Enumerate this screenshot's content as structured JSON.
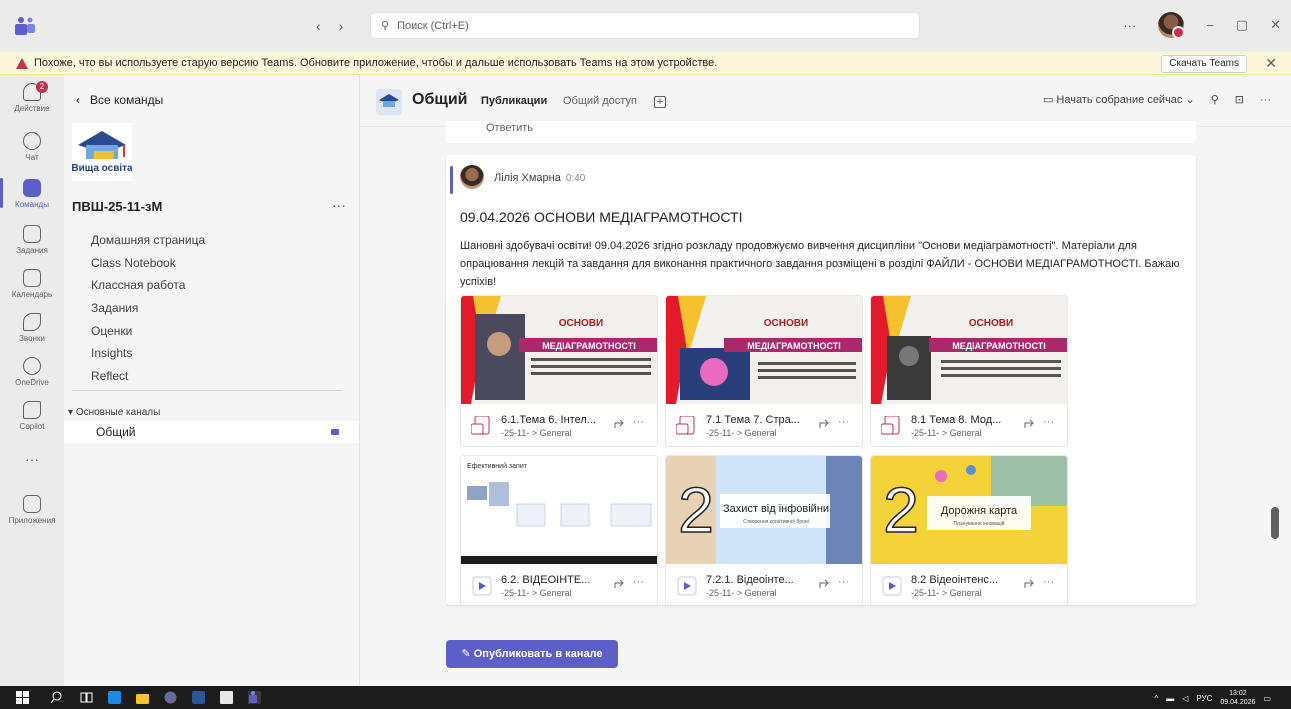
{
  "titlebar": {
    "search_placeholder": "Поиск (Ctrl+E)",
    "back": "‹",
    "forward": "›",
    "more": "···",
    "minimize": "−",
    "restore": "▢",
    "close": "✕"
  },
  "banner": {
    "text": "Похоже, что вы используете старую версию Teams. Обновите приложение, чтобы и дальше использовать Teams на этом устройстве.",
    "button": "Скачать Teams",
    "close": "✕"
  },
  "rail": {
    "items": [
      {
        "label": "Действие",
        "badge": "2"
      },
      {
        "label": "Чат"
      },
      {
        "label": "Команды"
      },
      {
        "label": "Задания"
      },
      {
        "label": "Календарь"
      },
      {
        "label": "Звонки"
      },
      {
        "label": "OneDrive"
      },
      {
        "label": "Copilot"
      },
      {
        "label": "···"
      },
      {
        "label": "Приложения"
      }
    ]
  },
  "sidebar": {
    "back_label": "Все команды",
    "logo_text": "Вища освіта",
    "team_name": "ПВШ-25-11-зМ",
    "team_more": "···",
    "nav": [
      "Домашняя страница",
      "Class Notebook",
      "Классная работа",
      "Задания",
      "Оценки",
      "Insights",
      "Reflect"
    ],
    "channels_header": "Основные каналы",
    "channel": "Общий"
  },
  "header": {
    "channel_title": "Общий",
    "tabs": [
      "Публикации",
      "Общий доступ"
    ],
    "add_tab": "+",
    "meet_label": "Начать собрание сейчас",
    "more": "···"
  },
  "reply_strip": {
    "label": "Ответить"
  },
  "post": {
    "author": "Лілія Хмарна",
    "time": "0:40",
    "title": "09.04.2026 ОСНОВИ МЕДІАГРАМОТНОСТІ",
    "body": "Шановні здобувачі освіти! 09.04.2026 згідно розкладу продовжуємо вивчення дисципліни \"Основи медіаграмотності\". Матеріали для опрацювання лекцій та завдання для виконання практичного завдання розміщені в розділі ФАЙЛИ - ОСНОВИ МЕДІАГРАМОТНОСТІ. Бажаю успіхів!",
    "files": [
      {
        "name": "6.1.Тема 6. Інтел...",
        "path": "-25-11- > General",
        "type": "pptx",
        "thumb_title": "ОСНОВИ",
        "thumb_sub": "МЕДІАГРАМОТНОСТІ"
      },
      {
        "name": "7.1 Тема 7. Стра...",
        "path": "-25-11- > General",
        "type": "pptx",
        "thumb_title": "ОСНОВИ",
        "thumb_sub": "МЕДІАГРАМОТНОСТІ"
      },
      {
        "name": "8.1 Тема 8. Мод...",
        "path": "-25-11- > General",
        "type": "pptx",
        "thumb_title": "ОСНОВИ",
        "thumb_sub": "МЕДІАГРАМОТНОСТІ"
      },
      {
        "name": "6.2. ВІДЕОІНТЕ...",
        "path": "-25-11- > General",
        "type": "video",
        "thumb_title": "Ефективний запит"
      },
      {
        "name": "7.2.1. Відеоінте...",
        "path": "-25-11- > General",
        "type": "video",
        "thumb_title": "Захист від інфовійни",
        "thumb_sub": "Створення когнітивної броні"
      },
      {
        "name": "8.2 Відеоінтенс...",
        "path": "-25-11- > General",
        "type": "video",
        "thumb_title": "Дорожня карта",
        "thumb_sub": "Планування інновацій"
      }
    ]
  },
  "publish_button": "Опубликовать в канале",
  "taskbar": {
    "lang": "РУС",
    "time": "13:02",
    "date": "09.04.2026"
  },
  "colors": {
    "accent": "#5b5fc7",
    "badge": "#c4314b"
  }
}
